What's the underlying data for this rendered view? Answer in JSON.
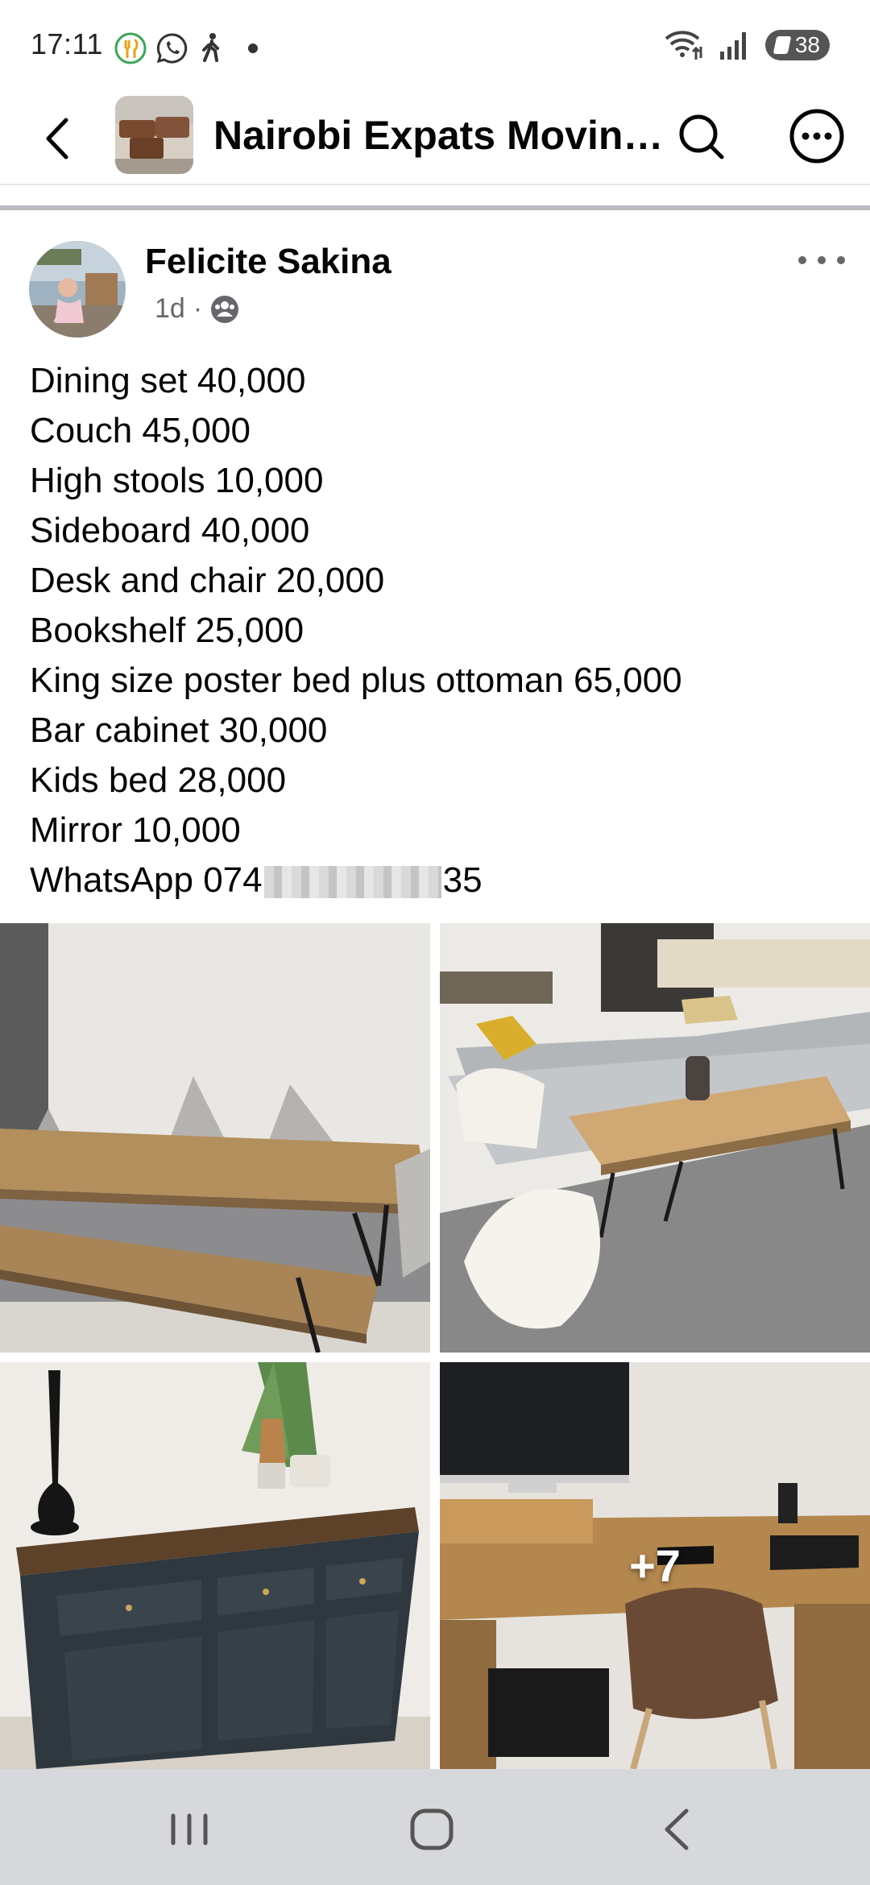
{
  "status_bar": {
    "time": "17:11",
    "battery_level": "38",
    "icons": [
      "food-delivery-icon",
      "whatsapp-icon",
      "walking-icon",
      "dot-icon",
      "wifi-icon",
      "signal-icon",
      "battery-icon"
    ]
  },
  "header": {
    "title": "Nairobi Expats Movin…",
    "icons": [
      "back-arrow-icon",
      "search-icon",
      "more-options-icon"
    ]
  },
  "post": {
    "author": "Felicite Sakina",
    "time_ago": "1d",
    "separator": "·",
    "audience_icon": "group-audience-icon",
    "lines": [
      "Dining set 40,000",
      "Couch 45,000",
      "High stools 10,000",
      "Sideboard 40,000",
      "Desk and chair 20,000",
      "Bookshelf 25,000",
      "King size poster bed plus ottoman 65,000",
      "Bar cabinet 30,000",
      "Kids bed 28,000",
      "Mirror 10,000"
    ],
    "whatsapp_prefix": "WhatsApp 074",
    "whatsapp_suffix": "35",
    "more_photos": "+7"
  },
  "colors": {
    "text": "#050505",
    "secondary_text": "#65676b",
    "divider": "#b8bbc0",
    "nav_bar": "#d7d8dc"
  }
}
